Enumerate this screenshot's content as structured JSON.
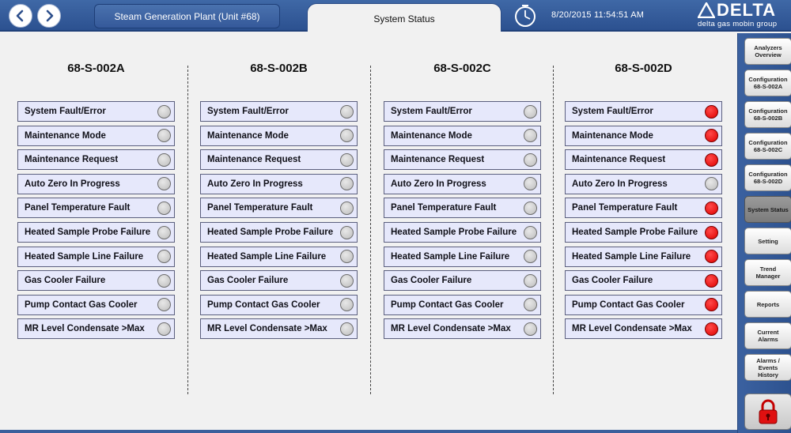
{
  "header": {
    "plant_title": "Steam Generation Plant (Unit #68)",
    "active_tab": "System Status",
    "datetime": "8/20/2015 11:54:51 AM",
    "logo_text": "DELTA",
    "logo_tagline": "delta gas mobin group"
  },
  "columns": [
    {
      "title": "68-S-002A",
      "statuses": [
        "off",
        "off",
        "off",
        "off",
        "off",
        "off",
        "off",
        "off",
        "off",
        "off"
      ]
    },
    {
      "title": "68-S-002B",
      "statuses": [
        "off",
        "off",
        "off",
        "off",
        "off",
        "off",
        "off",
        "off",
        "off",
        "off"
      ]
    },
    {
      "title": "68-S-002C",
      "statuses": [
        "off",
        "off",
        "off",
        "off",
        "off",
        "off",
        "off",
        "off",
        "off",
        "off"
      ]
    },
    {
      "title": "68-S-002D",
      "statuses": [
        "on",
        "on",
        "on",
        "off",
        "on",
        "on",
        "on",
        "on",
        "on",
        "on"
      ]
    }
  ],
  "status_labels": [
    "System Fault/Error",
    "Maintenance Mode",
    "Maintenance Request",
    "Auto Zero In Progress",
    "Panel Temperature Fault",
    "Heated Sample Probe Failure",
    "Heated Sample Line Failure",
    "Gas Cooler Failure",
    "Pump Contact Gas Cooler",
    "MR Level Condensate >Max"
  ],
  "sidebar": {
    "items": [
      {
        "label": "Analyzers\nOverview",
        "active": false
      },
      {
        "label": "Configuration\n68-S-002A",
        "active": false
      },
      {
        "label": "Configuration\n68-S-002B",
        "active": false
      },
      {
        "label": "Configuration\n68-S-002C",
        "active": false
      },
      {
        "label": "Configuration\n68-S-002D",
        "active": false
      },
      {
        "label": "System Status",
        "active": true
      },
      {
        "label": "Setting",
        "active": false
      },
      {
        "label": "Trend\nManager",
        "active": false
      },
      {
        "label": "Reports",
        "active": false
      },
      {
        "label": "Current\nAlarms",
        "active": false
      },
      {
        "label": "Alarms / Events\nHistory",
        "active": false
      }
    ],
    "lock_icon": "lock-icon"
  },
  "colors": {
    "header_blue": "#3a62a1",
    "led_on": "#e00000",
    "led_off": "#c4c4c4",
    "row_bg": "#e6e8fb"
  }
}
